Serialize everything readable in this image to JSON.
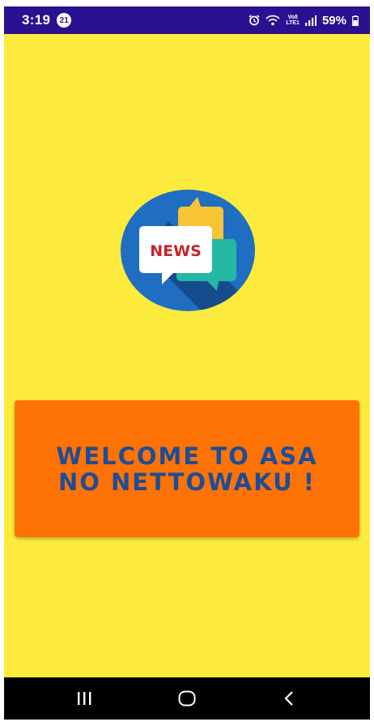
{
  "status_bar": {
    "time": "3:19",
    "notification_count": "21",
    "network_top": "Vo8",
    "network_bottom": "LTE1",
    "battery": "59%"
  },
  "logo": {
    "label": "NEWS"
  },
  "welcome": {
    "message": "WELCOME TO ASA NO NETTOWAKU !"
  },
  "nav_bar": {
    "icons": [
      "recent-apps-icon",
      "home-icon",
      "back-icon"
    ]
  },
  "colors": {
    "background": "#fceb3c",
    "status_bar": "#2a1190",
    "card": "#ff7304",
    "card_text": "#1f4c96"
  }
}
